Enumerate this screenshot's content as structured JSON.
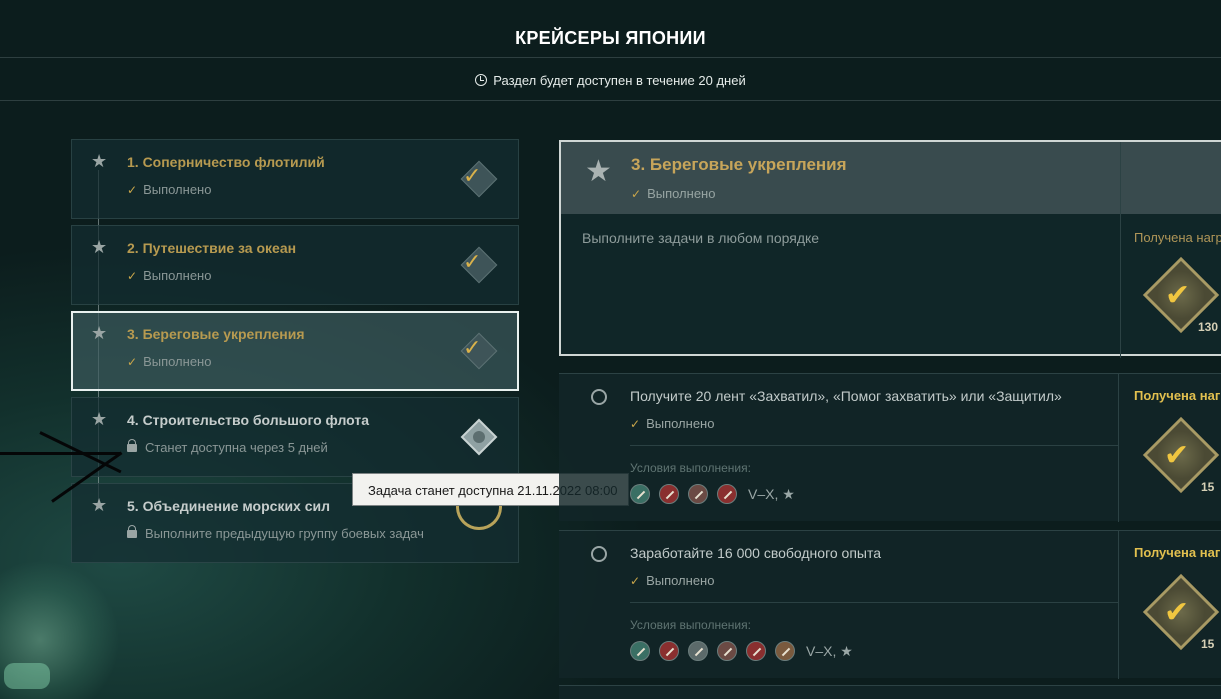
{
  "header": {
    "title": "КРЕЙСЕРЫ ЯПОНИИ",
    "subtitle": "Раздел будет доступен в течение 20 дней"
  },
  "groups": [
    {
      "title": "1. Соперничество флотилий",
      "status": "Выполнено"
    },
    {
      "title": "2. Путешествие за океан",
      "status": "Выполнено"
    },
    {
      "title": "3. Береговые укрепления",
      "status": "Выполнено"
    },
    {
      "title": "4. Строительство большого флота",
      "status": "Станет доступна через 5 дней"
    },
    {
      "title": "5. Объединение морских сил",
      "status": "Выполните предыдущую группу боевых задач"
    }
  ],
  "tooltip": "Задача станет доступна 21.11.2022 08:00",
  "detail": {
    "title": "3. Береговые укрепления",
    "status": "Выполнено",
    "description": "Выполните задачи в любом порядке",
    "reward_label": "Получена нагр",
    "reward_count": "130"
  },
  "tasks": [
    {
      "title": "Получите 20 лент «Захватил», «Помог захватить» или «Защитил»",
      "status": "Выполнено",
      "conditions_label": "Условия выполнения:",
      "tiers": "V–X, ★",
      "reward_label": "Получена нагр",
      "reward_count": "15"
    },
    {
      "title": "Заработайте 16 000 свободного опыта",
      "status": "Выполнено",
      "conditions_label": "Условия выполнения:",
      "tiers": "V–X, ★",
      "reward_label": "Получена нагр",
      "reward_count": "15"
    }
  ],
  "icons": {
    "star": "★",
    "check": "✓",
    "medal_check": "✔"
  },
  "colors": {
    "accent_gold": "#c7a55a",
    "reward_yellow": "#e2c04f"
  }
}
